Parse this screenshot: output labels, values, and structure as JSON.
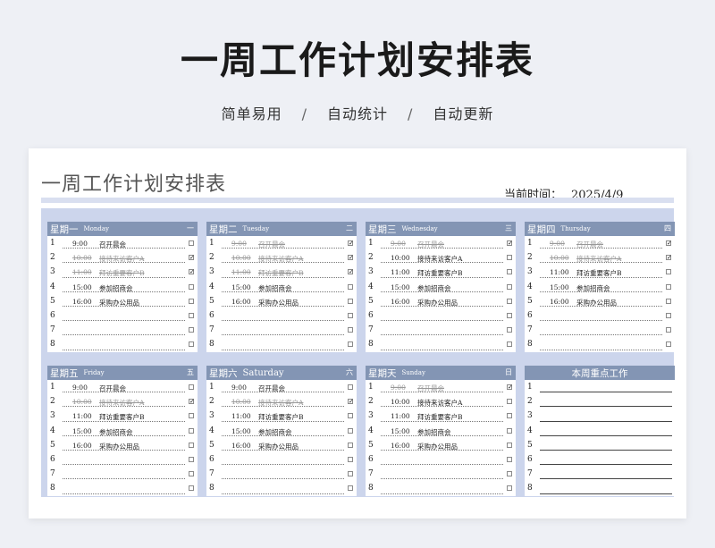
{
  "page": {
    "title": "一周工作计划安排表",
    "subtitle": [
      "简单易用",
      "自动统计",
      "自动更新"
    ],
    "separator": "/"
  },
  "sheet": {
    "title": "一周工作计划安排表",
    "date_label": "当前时间：",
    "date_value": "2025/4/9"
  },
  "days": [
    {
      "cn": "星期一",
      "en": "Monday",
      "num": "一",
      "tasks": [
        {
          "idx": "1",
          "time": "9:00",
          "task": "召开晨会",
          "done": false,
          "checked": false
        },
        {
          "idx": "2",
          "time": "10:00",
          "task": "接待来访客户A",
          "done": true,
          "checked": true
        },
        {
          "idx": "3",
          "time": "11:00",
          "task": "拜访重要客户B",
          "done": true,
          "checked": true
        },
        {
          "idx": "4",
          "time": "15:00",
          "task": "参加招商会",
          "done": false,
          "checked": false
        },
        {
          "idx": "5",
          "time": "16:00",
          "task": "采购办公用品",
          "done": false,
          "checked": false
        },
        {
          "idx": "6",
          "time": "",
          "task": "",
          "done": false,
          "checked": false
        },
        {
          "idx": "7",
          "time": "",
          "task": "",
          "done": false,
          "checked": false
        },
        {
          "idx": "8",
          "time": "",
          "task": "",
          "done": false,
          "checked": false
        }
      ]
    },
    {
      "cn": "星期二",
      "en": "Tuesday",
      "num": "二",
      "tasks": [
        {
          "idx": "1",
          "time": "9:00",
          "task": "召开晨会",
          "done": true,
          "checked": true
        },
        {
          "idx": "2",
          "time": "10:00",
          "task": "接待来访客户A",
          "done": true,
          "checked": true
        },
        {
          "idx": "3",
          "time": "11:00",
          "task": "拜访重要客户B",
          "done": true,
          "checked": true
        },
        {
          "idx": "4",
          "time": "15:00",
          "task": "参加招商会",
          "done": false,
          "checked": false
        },
        {
          "idx": "5",
          "time": "16:00",
          "task": "采购办公用品",
          "done": false,
          "checked": false
        },
        {
          "idx": "6",
          "time": "",
          "task": "",
          "done": false,
          "checked": false
        },
        {
          "idx": "7",
          "time": "",
          "task": "",
          "done": false,
          "checked": false
        },
        {
          "idx": "8",
          "time": "",
          "task": "",
          "done": false,
          "checked": false
        }
      ]
    },
    {
      "cn": "星期三",
      "en": "Wednesday",
      "num": "三",
      "tasks": [
        {
          "idx": "1",
          "time": "9:00",
          "task": "召开晨会",
          "done": true,
          "checked": true
        },
        {
          "idx": "2",
          "time": "10:00",
          "task": "接待来访客户A",
          "done": false,
          "checked": false
        },
        {
          "idx": "3",
          "time": "11:00",
          "task": "拜访重要客户B",
          "done": false,
          "checked": false
        },
        {
          "idx": "4",
          "time": "15:00",
          "task": "参加招商会",
          "done": false,
          "checked": false
        },
        {
          "idx": "5",
          "time": "16:00",
          "task": "采购办公用品",
          "done": false,
          "checked": false
        },
        {
          "idx": "6",
          "time": "",
          "task": "",
          "done": false,
          "checked": false
        },
        {
          "idx": "7",
          "time": "",
          "task": "",
          "done": false,
          "checked": false
        },
        {
          "idx": "8",
          "time": "",
          "task": "",
          "done": false,
          "checked": false
        }
      ]
    },
    {
      "cn": "星期四",
      "en": "Thursday",
      "num": "四",
      "tasks": [
        {
          "idx": "1",
          "time": "9:00",
          "task": "召开晨会",
          "done": true,
          "checked": true
        },
        {
          "idx": "2",
          "time": "10:00",
          "task": "接待来访客户A",
          "done": true,
          "checked": true
        },
        {
          "idx": "3",
          "time": "11:00",
          "task": "拜访重要客户B",
          "done": false,
          "checked": false
        },
        {
          "idx": "4",
          "time": "15:00",
          "task": "参加招商会",
          "done": false,
          "checked": false
        },
        {
          "idx": "5",
          "time": "16:00",
          "task": "采购办公用品",
          "done": false,
          "checked": false
        },
        {
          "idx": "6",
          "time": "",
          "task": "",
          "done": false,
          "checked": false
        },
        {
          "idx": "7",
          "time": "",
          "task": "",
          "done": false,
          "checked": false
        },
        {
          "idx": "8",
          "time": "",
          "task": "",
          "done": false,
          "checked": false
        }
      ]
    },
    {
      "cn": "星期五",
      "en": "Friday",
      "num": "五",
      "tasks": [
        {
          "idx": "1",
          "time": "9:00",
          "task": "召开晨会",
          "done": false,
          "checked": false
        },
        {
          "idx": "2",
          "time": "10:00",
          "task": "接待来访客户A",
          "done": true,
          "checked": true
        },
        {
          "idx": "3",
          "time": "11:00",
          "task": "拜访重要客户B",
          "done": false,
          "checked": false
        },
        {
          "idx": "4",
          "time": "15:00",
          "task": "参加招商会",
          "done": false,
          "checked": false
        },
        {
          "idx": "5",
          "time": "16:00",
          "task": "采购办公用品",
          "done": false,
          "checked": false
        },
        {
          "idx": "6",
          "time": "",
          "task": "",
          "done": false,
          "checked": false
        },
        {
          "idx": "7",
          "time": "",
          "task": "",
          "done": false,
          "checked": false
        },
        {
          "idx": "8",
          "time": "",
          "task": "",
          "done": false,
          "checked": false
        }
      ]
    },
    {
      "cn": "星期六",
      "en": "Saturday",
      "num": "六",
      "big": true,
      "tasks": [
        {
          "idx": "1",
          "time": "9:00",
          "task": "召开晨会",
          "done": false,
          "checked": false
        },
        {
          "idx": "2",
          "time": "10:00",
          "task": "接待来访客户A",
          "done": true,
          "checked": true
        },
        {
          "idx": "3",
          "time": "11:00",
          "task": "拜访重要客户B",
          "done": false,
          "checked": false
        },
        {
          "idx": "4",
          "time": "15:00",
          "task": "参加招商会",
          "done": false,
          "checked": false
        },
        {
          "idx": "5",
          "time": "16:00",
          "task": "采购办公用品",
          "done": false,
          "checked": false
        },
        {
          "idx": "6",
          "time": "",
          "task": "",
          "done": false,
          "checked": false
        },
        {
          "idx": "7",
          "time": "",
          "task": "",
          "done": false,
          "checked": false
        },
        {
          "idx": "8",
          "time": "",
          "task": "",
          "done": false,
          "checked": false
        }
      ]
    },
    {
      "cn": "星期天",
      "en": "Sunday",
      "num": "日",
      "tasks": [
        {
          "idx": "1",
          "time": "9:00",
          "task": "召开晨会",
          "done": true,
          "checked": true
        },
        {
          "idx": "2",
          "time": "10:00",
          "task": "接待来访客户A",
          "done": false,
          "checked": false
        },
        {
          "idx": "3",
          "time": "11:00",
          "task": "拜访重要客户B",
          "done": false,
          "checked": false
        },
        {
          "idx": "4",
          "time": "15:00",
          "task": "参加招商会",
          "done": false,
          "checked": false
        },
        {
          "idx": "5",
          "time": "16:00",
          "task": "采购办公用品",
          "done": false,
          "checked": false
        },
        {
          "idx": "6",
          "time": "",
          "task": "",
          "done": false,
          "checked": false
        },
        {
          "idx": "7",
          "time": "",
          "task": "",
          "done": false,
          "checked": false
        },
        {
          "idx": "8",
          "time": "",
          "task": "",
          "done": false,
          "checked": false
        }
      ]
    }
  ],
  "focus": {
    "title": "本周重点工作",
    "rows": [
      "1",
      "2",
      "3",
      "4",
      "5",
      "6",
      "7",
      "8"
    ]
  },
  "colors": {
    "header": "#8395b4",
    "band": "#ccd5ec"
  }
}
